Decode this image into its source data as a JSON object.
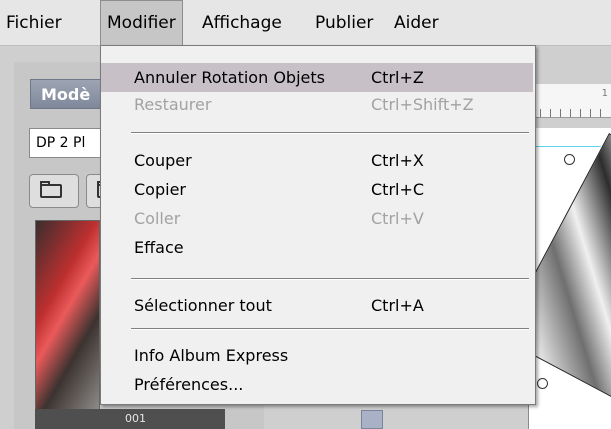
{
  "menubar": {
    "items": [
      {
        "label": "Fichier"
      },
      {
        "label": "Modifier"
      },
      {
        "label": "Affichage"
      },
      {
        "label": "Publier"
      },
      {
        "label": "Aider"
      }
    ]
  },
  "left_panel": {
    "title": "Modè",
    "dropdown_value": "DP 2 Pl",
    "thumbnail_label": "001"
  },
  "ruler": {
    "label": "1"
  },
  "modifier_menu": {
    "items": [
      {
        "label": "Annuler Rotation Objets",
        "shortcut": "Ctrl+Z",
        "enabled": true,
        "highlighted": true
      },
      {
        "label": "Restaurer",
        "shortcut": "Ctrl+Shift+Z",
        "enabled": false
      },
      {
        "label": "Couper",
        "shortcut": "Ctrl+X",
        "enabled": true
      },
      {
        "label": "Copier",
        "shortcut": "Ctrl+C",
        "enabled": true
      },
      {
        "label": "Coller",
        "shortcut": "Ctrl+V",
        "enabled": false
      },
      {
        "label": "Efface",
        "shortcut": "",
        "enabled": true
      },
      {
        "label": "Sélectionner tout",
        "shortcut": "Ctrl+A",
        "enabled": true
      },
      {
        "label": "Info Album Express",
        "shortcut": "",
        "enabled": true
      },
      {
        "label": "Préférences...",
        "shortcut": "",
        "enabled": true
      }
    ]
  },
  "colors": {
    "menu_highlight": "#c7c1c7",
    "guide_line": "#5ed2ef",
    "panel_title": "#8a93a6"
  }
}
